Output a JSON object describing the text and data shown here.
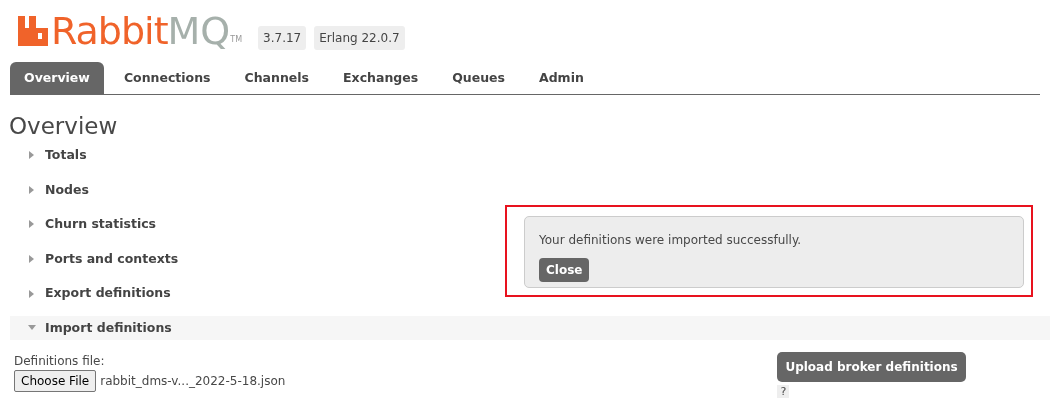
{
  "logo": {
    "text_primary": "Rabbit",
    "text_secondary": "MQ",
    "trademark": "TM"
  },
  "versions": [
    "3.7.17",
    "Erlang 22.0.7"
  ],
  "tabs": [
    {
      "label": "Overview",
      "selected": true
    },
    {
      "label": "Connections",
      "selected": false
    },
    {
      "label": "Channels",
      "selected": false
    },
    {
      "label": "Exchanges",
      "selected": false
    },
    {
      "label": "Queues",
      "selected": false
    },
    {
      "label": "Admin",
      "selected": false
    }
  ],
  "heading": "Overview",
  "sections": [
    {
      "title": "Totals",
      "expanded": false
    },
    {
      "title": "Nodes",
      "expanded": false
    },
    {
      "title": "Churn statistics",
      "expanded": false
    },
    {
      "title": "Ports and contexts",
      "expanded": false
    },
    {
      "title": "Export definitions",
      "expanded": false
    },
    {
      "title": "Import definitions",
      "expanded": true
    }
  ],
  "import_form": {
    "file_label": "Definitions file:",
    "choose_button": "Choose File",
    "file_name": "rabbit_dms-v..._2022-5-18.json",
    "upload_button": "Upload broker definitions",
    "help": "?"
  },
  "notification": {
    "message": "Your definitions were imported successfully.",
    "close_button": "Close",
    "highlighted": true
  }
}
